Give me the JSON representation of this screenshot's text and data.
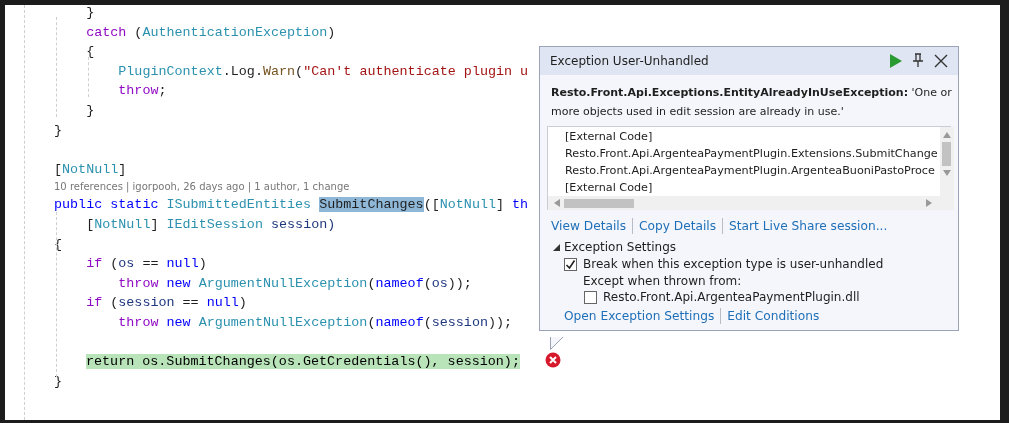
{
  "editor": {
    "lines": [
      {
        "kind": "code",
        "tokens": [
          {
            "text": "    }",
            "kind": "plain"
          }
        ]
      },
      {
        "kind": "code",
        "tokens": [
          {
            "text": "    catch",
            "kind": "ctl"
          },
          {
            "text": " (",
            "kind": "plain"
          },
          {
            "text": "AuthenticationException",
            "kind": "type"
          },
          {
            "text": ")",
            "kind": "plain"
          }
        ]
      },
      {
        "kind": "code",
        "tokens": [
          {
            "text": "    {",
            "kind": "plain"
          }
        ]
      },
      {
        "kind": "code",
        "tokens": [
          {
            "text": "        PluginContext",
            "kind": "type"
          },
          {
            "text": ".Log.",
            "kind": "plain"
          },
          {
            "text": "Warn",
            "kind": "method"
          },
          {
            "text": "(",
            "kind": "plain"
          },
          {
            "text": "\"Can't authenticate plugin u",
            "kind": "str"
          }
        ]
      },
      {
        "kind": "code",
        "tokens": [
          {
            "text": "        throw",
            "kind": "ctl"
          },
          {
            "text": ";",
            "kind": "plain"
          }
        ]
      },
      {
        "kind": "code",
        "tokens": [
          {
            "text": "    }",
            "kind": "plain"
          }
        ]
      },
      {
        "kind": "code",
        "tokens": [
          {
            "text": "}",
            "kind": "plain"
          }
        ]
      },
      {
        "kind": "blank"
      },
      {
        "kind": "code",
        "tokens": [
          {
            "text": "[",
            "kind": "plain"
          },
          {
            "text": "NotNull",
            "kind": "type"
          },
          {
            "text": "]",
            "kind": "plain"
          }
        ]
      },
      {
        "kind": "lens",
        "text": "10 references | igorpooh, 26 days ago | 1 author, 1 change"
      },
      {
        "kind": "code",
        "tokens": [
          {
            "text": "public static ",
            "kind": "kw"
          },
          {
            "text": "ISubmittedEntities ",
            "kind": "type"
          },
          {
            "text": "SubmitChanges",
            "kind": "match"
          },
          {
            "text": "([",
            "kind": "plain"
          },
          {
            "text": "NotNull",
            "kind": "type"
          },
          {
            "text": "] ",
            "kind": "plain"
          },
          {
            "text": "th",
            "kind": "kw"
          }
        ]
      },
      {
        "kind": "code",
        "tokens": [
          {
            "text": "    [",
            "kind": "plain"
          },
          {
            "text": "NotNull",
            "kind": "type"
          },
          {
            "text": "] ",
            "kind": "plain"
          },
          {
            "text": "IEditSession",
            "kind": "type"
          },
          {
            "text": " session)",
            "kind": "param"
          }
        ]
      },
      {
        "kind": "code",
        "tokens": [
          {
            "text": "{",
            "kind": "plain"
          }
        ]
      },
      {
        "kind": "code",
        "tokens": [
          {
            "text": "    if",
            "kind": "ctl"
          },
          {
            "text": " (",
            "kind": "plain"
          },
          {
            "text": "os",
            "kind": "param"
          },
          {
            "text": " == ",
            "kind": "plain"
          },
          {
            "text": "null",
            "kind": "kw"
          },
          {
            "text": ")",
            "kind": "plain"
          }
        ]
      },
      {
        "kind": "code",
        "tokens": [
          {
            "text": "        throw",
            "kind": "ctl"
          },
          {
            "text": " new ",
            "kind": "kw"
          },
          {
            "text": "ArgumentNullException",
            "kind": "type"
          },
          {
            "text": "(",
            "kind": "plain"
          },
          {
            "text": "nameof",
            "kind": "kw"
          },
          {
            "text": "(",
            "kind": "plain"
          },
          {
            "text": "os",
            "kind": "param"
          },
          {
            "text": "));",
            "kind": "plain"
          }
        ]
      },
      {
        "kind": "code",
        "tokens": [
          {
            "text": "    if",
            "kind": "ctl"
          },
          {
            "text": " (",
            "kind": "plain"
          },
          {
            "text": "session",
            "kind": "param"
          },
          {
            "text": " == ",
            "kind": "plain"
          },
          {
            "text": "null",
            "kind": "kw"
          },
          {
            "text": ")",
            "kind": "plain"
          }
        ]
      },
      {
        "kind": "code",
        "tokens": [
          {
            "text": "        throw",
            "kind": "ctl"
          },
          {
            "text": " new ",
            "kind": "kw"
          },
          {
            "text": "ArgumentNullException",
            "kind": "type"
          },
          {
            "text": "(",
            "kind": "plain"
          },
          {
            "text": "nameof",
            "kind": "kw"
          },
          {
            "text": "(",
            "kind": "plain"
          },
          {
            "text": "session",
            "kind": "param"
          },
          {
            "text": "));",
            "kind": "plain"
          }
        ]
      },
      {
        "kind": "blank"
      },
      {
        "kind": "current",
        "text": "return os.SubmitChanges(os.GetCredentials(), session);"
      },
      {
        "kind": "code",
        "tokens": [
          {
            "text": "}",
            "kind": "plain"
          }
        ]
      }
    ]
  },
  "exception_popup": {
    "title": "Exception User-Unhandled",
    "message": "**Resto.Front.Api.Exceptions.EntityAlreadyInUseException:** 'One or more objects used in edit session are already in use.'",
    "call_stack": [
      "[External Code]",
      "Resto.Front.Api.ArgenteaPaymentPlugin.Extensions.SubmitChange",
      "Resto.Front.Api.ArgenteaPaymentPlugin.ArgenteaBuoniPastoProce",
      "[External Code]"
    ],
    "links": [
      "View Details",
      "Copy Details",
      "Start Live Share session..."
    ],
    "exception_settings": {
      "label": "Exception Settings",
      "expanded": true,
      "break_option": {
        "label": "Break when this exception type is user-unhandled",
        "checked": true
      },
      "except_label": "Except when thrown from:",
      "modules": [
        {
          "label": "Resto.Front.Api.ArgenteaPaymentPlugin.dll",
          "checked": false
        }
      ],
      "links": [
        "Open Exception Settings",
        "Edit Conditions"
      ]
    }
  }
}
